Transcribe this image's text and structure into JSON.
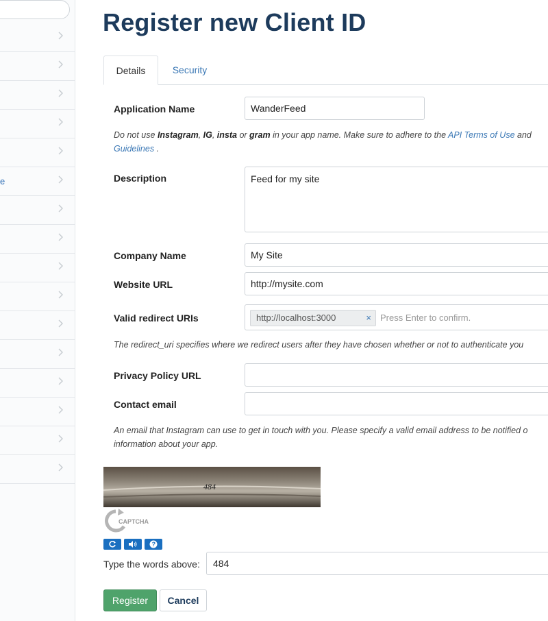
{
  "page": {
    "title": "Register new Client ID"
  },
  "tabs": [
    {
      "label": "Details",
      "active": true
    },
    {
      "label": "Security",
      "active": false
    }
  ],
  "sidebar": {
    "items": [
      {
        "label": ""
      },
      {
        "label": ""
      },
      {
        "label": ""
      },
      {
        "label": ""
      },
      {
        "label": ""
      },
      {
        "label": "e"
      },
      {
        "label": ""
      },
      {
        "label": ""
      },
      {
        "label": ""
      },
      {
        "label": ""
      },
      {
        "label": ""
      },
      {
        "label": ""
      },
      {
        "label": ""
      },
      {
        "label": ""
      },
      {
        "label": ""
      },
      {
        "label": ""
      }
    ]
  },
  "form": {
    "app_name": {
      "label": "Application Name",
      "value": "WanderFeed"
    },
    "app_name_help": {
      "t1": "Do not use ",
      "w1": "Instagram",
      "t2": ", ",
      "w2": "IG",
      "t3": ", ",
      "w3": "insta",
      "t4": " or ",
      "w4": "gram",
      "t5": " in your app name. Make sure to adhere to the ",
      "link1": "API Terms of Use",
      "t6": " and",
      "link2": "Guidelines",
      "t7": " ."
    },
    "description": {
      "label": "Description",
      "value": "Feed for my site"
    },
    "company": {
      "label": "Company Name",
      "value": "My Site"
    },
    "website": {
      "label": "Website URL",
      "value": "http://mysite.com"
    },
    "redirect": {
      "label": "Valid redirect URIs",
      "tag": "http://localhost:3000",
      "remove": "×",
      "placeholder": "Press Enter to confirm."
    },
    "redirect_help": "The redirect_uri specifies where we redirect users after they have chosen whether or not to authenticate you",
    "privacy": {
      "label": "Privacy Policy URL",
      "value": ""
    },
    "contact": {
      "label": "Contact email",
      "value": ""
    },
    "contact_help_1": "An email that Instagram can use to get in touch with you. Please specify a valid email address to be notified o",
    "contact_help_2": "information about your app."
  },
  "captcha": {
    "image_text": "484",
    "logo_text": "CAPTCHA",
    "type_label": "Type the words above:",
    "value": "484"
  },
  "buttons": {
    "register": "Register",
    "cancel": "Cancel"
  },
  "colors": {
    "brand_navy": "#1d3b5c",
    "link": "#3b78b5",
    "register_green": "#4fa36b",
    "captcha_blue": "#1a6fc0"
  }
}
